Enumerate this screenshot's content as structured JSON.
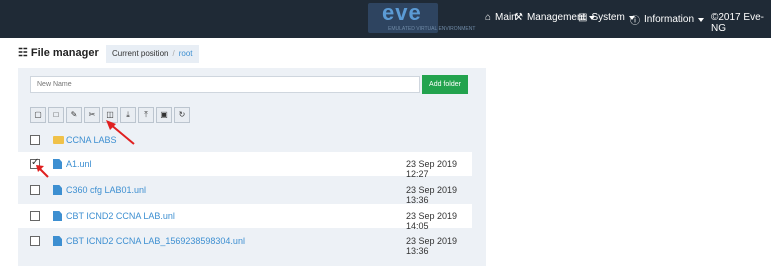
{
  "logo": {
    "text": "eve",
    "subtitle": "EMULATED VIRTUAL ENVIRONMENT"
  },
  "nav": {
    "main": "Main",
    "management": "Management",
    "system": "System",
    "information": "Information",
    "copyright": "©2017 Eve-NG"
  },
  "header": {
    "title": "File manager",
    "current_position_label": "Current position",
    "breadcrumb_separator": "/",
    "breadcrumb_root": "root"
  },
  "form": {
    "new_name_placeholder": "New Name",
    "add_folder_label": "Add folder"
  },
  "toolbar": {
    "buttons": [
      "select-all-icon",
      "file-icon",
      "pencil-icon",
      "scissors-icon",
      "trash-icon",
      "download-icon",
      "upload-icon",
      "export-icon",
      "refresh-icon"
    ]
  },
  "files": [
    {
      "name": "CCNA LABS",
      "type": "folder",
      "date": "",
      "checked": false
    },
    {
      "name": "A1.unl",
      "type": "file",
      "date": "23 Sep 2019 12:27",
      "checked": true
    },
    {
      "name": "C360 cfg LAB01.unl",
      "type": "file",
      "date": "23 Sep 2019 13:36",
      "checked": false
    },
    {
      "name": "CBT ICND2 CCNA LAB.unl",
      "type": "file",
      "date": "23 Sep 2019 14:05",
      "checked": false
    },
    {
      "name": "CBT ICND2 CCNA LAB_1569238598304.unl",
      "type": "file",
      "date": "23 Sep 2019 13:36",
      "checked": false
    }
  ],
  "colors": {
    "topbar": "#1f2a36",
    "link": "#3d8fd1",
    "add_button": "#23a34e",
    "annotation_arrow": "#e02020"
  }
}
